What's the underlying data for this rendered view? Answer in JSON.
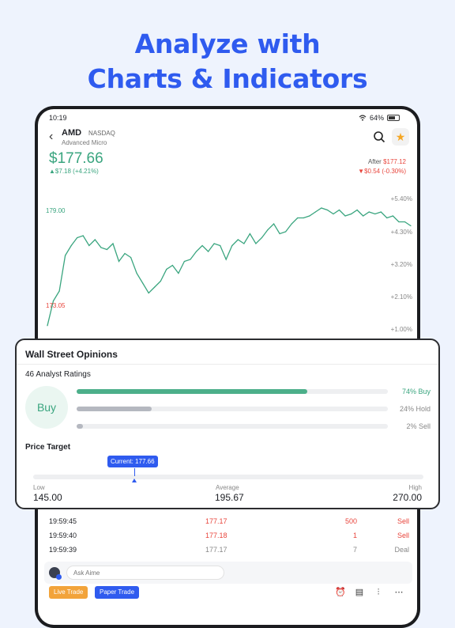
{
  "headline": {
    "line1": "Analyze with",
    "line2": "Charts & Indicators"
  },
  "status_bar": {
    "time": "10:19",
    "battery": "64%"
  },
  "stock": {
    "symbol": "AMD",
    "exchange": "NASDAQ",
    "name": "Advanced Micro",
    "price": "$177.66",
    "change": "▲$7.18  (+4.21%)",
    "after_label": "After",
    "after_price": "$177.12",
    "after_change": "▼$0.54  (-0.30%)"
  },
  "chart": {
    "high_label": "179.00",
    "low_label": "173.05",
    "pct_labels": [
      "+5.40%",
      "+4.30%",
      "+3.20%",
      "+2.10%",
      "+1.00%"
    ],
    "line_color": "#3aa57f"
  },
  "chart_data": {
    "type": "line",
    "title": "",
    "xlabel": "",
    "ylabel": "",
    "ylim": [
      172.4,
      180.0
    ],
    "series": [
      {
        "values": [
          173.05,
          174.3,
          174.8,
          176.6,
          177.1,
          177.5,
          177.6,
          177.1,
          177.4,
          177.0,
          176.9,
          177.2,
          176.3,
          176.7,
          176.5,
          175.7,
          175.2,
          174.7,
          175.0,
          175.3,
          175.9,
          176.1,
          175.7,
          176.3,
          176.4,
          176.8,
          177.1,
          176.8,
          177.2,
          177.1,
          176.4,
          177.1,
          177.4,
          177.2,
          177.7,
          177.2,
          177.5,
          177.9,
          178.2,
          177.7,
          177.8,
          178.2,
          178.5,
          178.5,
          178.6,
          178.8,
          179.0,
          178.9,
          178.7,
          178.9,
          178.6,
          178.7,
          178.9,
          178.6,
          178.8,
          178.7,
          178.8,
          178.5,
          178.6,
          178.3,
          178.3,
          178.1
        ]
      }
    ]
  },
  "opinions": {
    "title": "Wall Street Opinions",
    "ratings_title": "46 Analyst Ratings",
    "consensus": "Buy",
    "bars": [
      {
        "label": "74% Buy",
        "value": 0.74,
        "color": "#4caf8a",
        "label_color": "#3aa57f"
      },
      {
        "label": "24% Hold",
        "value": 0.24,
        "color": "#b5b8c0",
        "label_color": "#888888"
      },
      {
        "label": "2% Sell",
        "value": 0.02,
        "color": "#b5b8c0",
        "label_color": "#888888"
      }
    ],
    "price_target_title": "Price Target",
    "current_label": "Current: 177.66",
    "current_fraction": 0.259,
    "low_label": "Low",
    "low_value": "145.00",
    "average_label": "Average",
    "average_value": "195.67",
    "high_label": "High",
    "high_value": "270.00"
  },
  "trades": [
    {
      "time": "19:59:45",
      "price": "177.17",
      "qty": "500",
      "side": "Sell",
      "color": "#e8453c"
    },
    {
      "time": "19:59:40",
      "price": "177.18",
      "qty": "1",
      "side": "Sell",
      "color": "#e8453c"
    },
    {
      "time": "19:59:39",
      "price": "177.17",
      "qty": "7",
      "side": "Deal",
      "color": "#888888"
    }
  ],
  "bottom": {
    "ask_placeholder": "Ask Aime",
    "live_trade": "Live Trade",
    "paper_trade": "Paper Trade",
    "live_color": "#f2a33a",
    "paper_color": "#2f5bef"
  }
}
